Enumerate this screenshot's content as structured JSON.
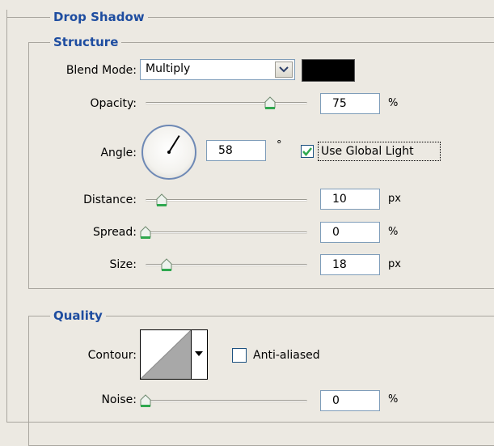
{
  "drop_shadow": {
    "title": "Drop Shadow"
  },
  "structure": {
    "title": "Structure",
    "blend_mode_label": "Blend Mode:",
    "blend_mode_value": "Multiply",
    "shadow_color": "#000000",
    "opacity": {
      "label": "Opacity:",
      "value": "75",
      "unit": "%",
      "slider_fraction": 0.75
    },
    "angle": {
      "label": "Angle:",
      "value": "58",
      "unit": "°",
      "degrees": 58
    },
    "use_global_light": {
      "label": "Use Global Light",
      "checked": true
    },
    "distance": {
      "label": "Distance:",
      "value": "10",
      "unit": "px",
      "slider_fraction": 0.1
    },
    "spread": {
      "label": "Spread:",
      "value": "0",
      "unit": "%",
      "slider_fraction": 0
    },
    "size": {
      "label": "Size:",
      "value": "18",
      "unit": "px",
      "slider_fraction": 0.13
    }
  },
  "quality": {
    "title": "Quality",
    "contour_label": "Contour:",
    "anti_aliased": {
      "label": "Anti-aliased",
      "checked": false
    },
    "noise": {
      "label": "Noise:",
      "value": "0",
      "unit": "%",
      "slider_fraction": 0
    }
  },
  "colors": {
    "group_title": "#1e4da0",
    "slider_thumb_accent": "#2fa84f",
    "check_mark": "#2fa84f"
  },
  "icons": [
    "chevron-down-icon",
    "checkmark-icon",
    "dropdown-arrow-icon"
  ]
}
